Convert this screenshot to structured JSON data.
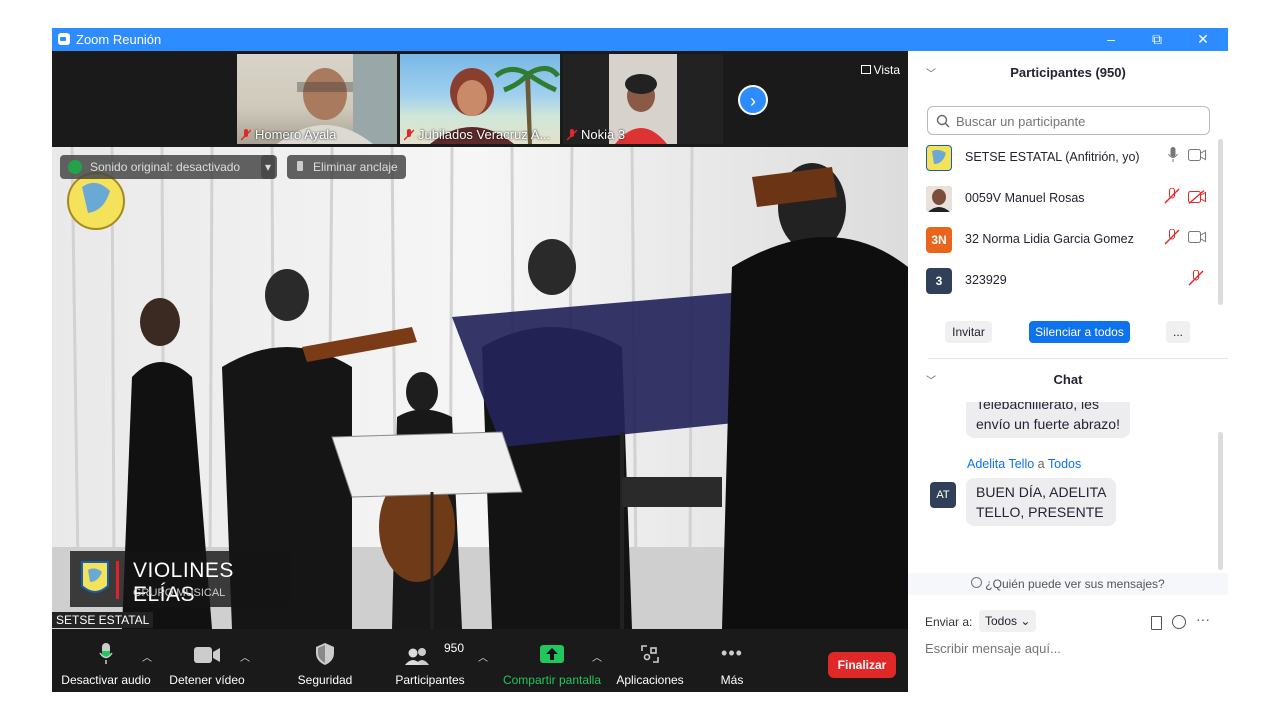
{
  "window": {
    "title": "Zoom Reunión",
    "minimize": "–",
    "restore": "⧉",
    "close": "✕"
  },
  "video": {
    "view_label": "Vista",
    "thumbnails": [
      {
        "name": "Homero Ayala"
      },
      {
        "name": "Jubilados Veracruz A..."
      },
      {
        "name": "Nokia 3"
      }
    ],
    "overlay": {
      "original_sound": "Sonido original: desactivado",
      "unpin": "Eliminar anclaje"
    },
    "lower_third": {
      "title": "VIOLINES ELÍAS",
      "subtitle": "GRUPO MUSICAL"
    },
    "speaker_name": "SETSE ESTATAL"
  },
  "toolbar": {
    "mute": "Desactivar audio",
    "stop_video": "Detener vídeo",
    "security": "Seguridad",
    "participants": "Participantes",
    "participants_count": "950",
    "share": "Compartir pantalla",
    "apps": "Aplicaciones",
    "more": "Más",
    "end": "Finalizar"
  },
  "participants_panel": {
    "title": "Participantes (950)",
    "search_placeholder": "Buscar un participante",
    "participants": [
      {
        "name": "SETSE ESTATAL (Anfitrión, yo)",
        "avatar_text": ""
      },
      {
        "name": "0059V Manuel Rosas",
        "avatar_text": ""
      },
      {
        "name": "32 Norma Lidia Garcia Gomez",
        "avatar_text": "3N"
      },
      {
        "name": "323929",
        "avatar_text": "3"
      }
    ],
    "invite": "Invitar",
    "mute_all": "Silenciar a todos",
    "more": "..."
  },
  "chat": {
    "title": "Chat",
    "messages": [
      {
        "text_line1": "Telebachillerato, les",
        "text_line2": "envío un fuerte abrazo!"
      },
      {
        "sender": "Adelita Tello",
        "connector": "a",
        "recipient": "Todos",
        "avatar_text": "AT",
        "text_line1": "BUEN DÍA, ADELITA",
        "text_line2": "TELLO, PRESENTE"
      }
    ],
    "who_can_see": "¿Quién puede ver sus mensajes?",
    "send_to_label": "Enviar a:",
    "send_to_value": "Todos",
    "more": "···",
    "input_placeholder": "Escribir mensaje aquí..."
  },
  "colors": {
    "accent": "#2d8cff",
    "end_button": "#e02828",
    "share_green": "#22c55e",
    "mute_red": "#e02828"
  }
}
